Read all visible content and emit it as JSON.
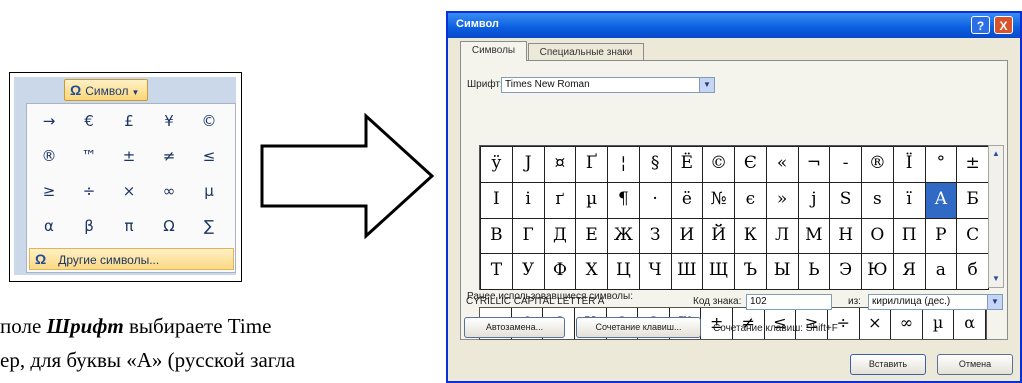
{
  "ribbon": {
    "button_label": "Символ",
    "button_icon": "omega-icon",
    "symbols": [
      "→",
      "€",
      "£",
      "¥",
      "©",
      "®",
      "™",
      "±",
      "≠",
      "≤",
      "≥",
      "÷",
      "×",
      "∞",
      "µ",
      "α",
      "β",
      "π",
      "Ω",
      "∑"
    ],
    "more_label": "Другие символы..."
  },
  "text": {
    "line1_start": "поле ",
    "line1_bold": "Шрифт",
    "line1_end": " выбираете Time",
    "line2": "ер, для буквы «А» (русской загла"
  },
  "dialog": {
    "title": "Символ",
    "tabs": [
      "Символы",
      "Специальные знаки"
    ],
    "font_label": "Шрифт:",
    "font_value": "Times New Roman",
    "grid": [
      [
        "ÿ",
        "Ј",
        "¤",
        "Ґ",
        "¦",
        "§",
        "Ё",
        "©",
        "Є",
        "«",
        "¬",
        "-",
        "®",
        "Ї",
        "°",
        "±"
      ],
      [
        "І",
        "і",
        "ґ",
        "µ",
        "¶",
        "·",
        "ё",
        "№",
        "є",
        "»",
        "ј",
        "Ѕ",
        "ѕ",
        "ї",
        "А",
        "Б"
      ],
      [
        "В",
        "Г",
        "Д",
        "Е",
        "Ж",
        "З",
        "И",
        "Й",
        "К",
        "Л",
        "М",
        "Н",
        "О",
        "П",
        "Р",
        "С"
      ],
      [
        "Т",
        "У",
        "Ф",
        "Х",
        "Ц",
        "Ч",
        "Ш",
        "Щ",
        "Ъ",
        "Ы",
        "Ь",
        "Э",
        "Ю",
        "Я",
        "а",
        "б"
      ]
    ],
    "recent_label": "Ранее использовавшиеся символы:",
    "recent": [
      "→",
      "€",
      "£",
      "¥",
      "©",
      "®",
      "™",
      "±",
      "≠",
      "≤",
      "≥",
      "÷",
      "×",
      "∞",
      "µ",
      "α"
    ],
    "char_name": "CYRILLIC CAPITAL LETTER A",
    "code_label": "Код знака:",
    "code_value": "102",
    "from_label": "из:",
    "from_value": "кириллица (дес.)",
    "autocorrect_label": "Автозамена...",
    "shortcut_btn_label": "Сочетание клавиш...",
    "shortcut_text": "Сочетание клавиш: Shift+F",
    "insert_label": "Вставить",
    "cancel_label": "Отмена",
    "help_glyph": "?",
    "close_glyph": "X",
    "selected_row": 1,
    "selected_col": 14
  }
}
